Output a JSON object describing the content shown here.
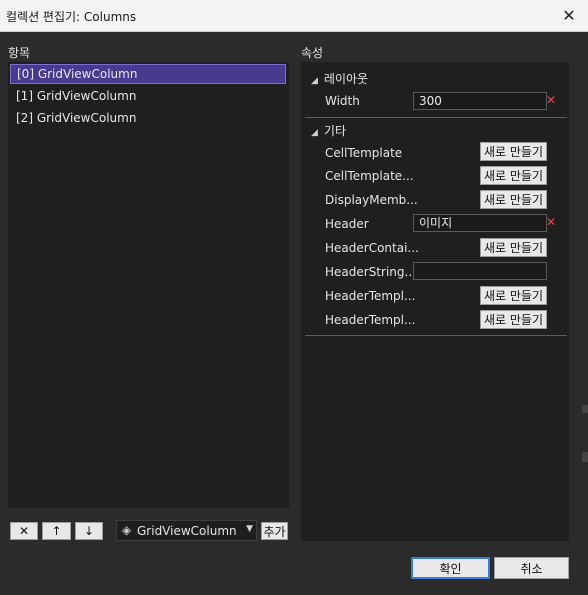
{
  "window": {
    "title": "컬렉션 편집기: Columns",
    "close_glyph": "✕"
  },
  "items_section": {
    "label": "항목",
    "items": [
      "[0] GridViewColumn",
      "[1] GridViewColumn",
      "[2] GridViewColumn"
    ],
    "selected_index": 0
  },
  "toolbar": {
    "remove": "✕",
    "up": "↑",
    "down": "↓",
    "type_combo": "GridViewColumn",
    "add": "추가"
  },
  "props_section": {
    "label": "속성",
    "layout_group": {
      "title": "레이아웃",
      "width_label": "Width",
      "width_value": "300"
    },
    "misc_group": {
      "title": "기타",
      "cell_template": "CellTemplate",
      "cell_template_selector": "CellTemplate...",
      "display_member": "DisplayMemb...",
      "header": "Header",
      "header_value": "이미지",
      "header_container": "HeaderContai...",
      "header_string": "HeaderString...",
      "header_template": "HeaderTempl...",
      "header_template_selector": "HeaderTempl...",
      "new_button": "새로 만들기"
    },
    "reset_glyph": "✕"
  },
  "buttons": {
    "ok": "확인",
    "cancel": "취소"
  },
  "colors": {
    "selected_item": "#4a3a8f",
    "panel_bg": "#1f1f1f",
    "reset_x": "#e04a4a"
  }
}
